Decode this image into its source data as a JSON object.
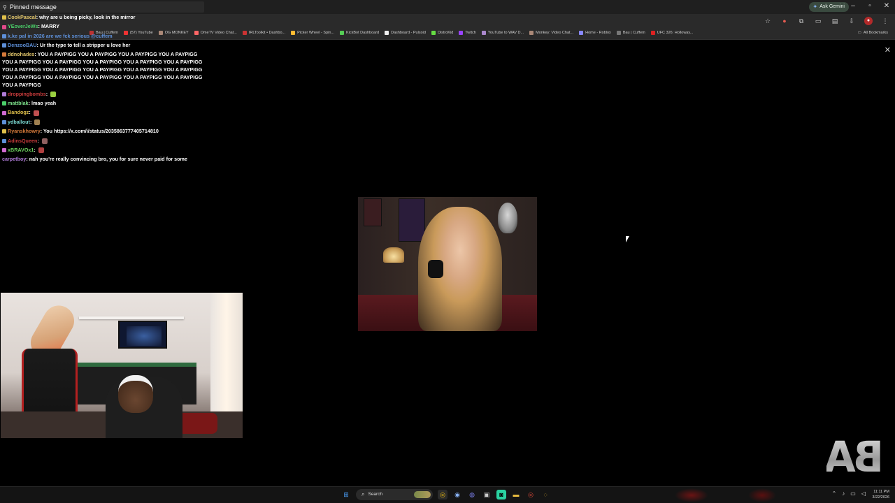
{
  "pinned": {
    "label": "Pinned message"
  },
  "window": {
    "ask_gemini": "Ask Gemini"
  },
  "bookmarks": {
    "items": [
      {
        "label": "Bau | Cuffem",
        "color": "#b33"
      },
      {
        "label": "(57) YouTube",
        "color": "#e33"
      },
      {
        "label": "OG MONKEY",
        "color": "#a87"
      },
      {
        "label": "OmeTV Video Chat...",
        "color": "#f66"
      },
      {
        "label": "IRLToolkit • Dashbo...",
        "color": "#c33"
      },
      {
        "label": "Picker Wheel - Spin...",
        "color": "#fb3"
      },
      {
        "label": "KickBot Dashboard",
        "color": "#5c5"
      },
      {
        "label": "Dashboard - Pulsoid",
        "color": "#eee"
      },
      {
        "label": "DistroKid",
        "color": "#6d4"
      },
      {
        "label": "Twitch",
        "color": "#94f"
      },
      {
        "label": "YouTube to WAV D...",
        "color": "#a8c"
      },
      {
        "label": "Monkey: Video Chat...",
        "color": "#a87"
      },
      {
        "label": "Home - Roblox",
        "color": "#88f"
      },
      {
        "label": "Bau | Cuffem",
        "color": "#777"
      },
      {
        "label": "UFC 326: Holloway...",
        "color": "#d22"
      }
    ],
    "all_bookmarks": "All Bookmarks"
  },
  "chat": [
    {
      "user": "CookPascal",
      "user_color": "gold",
      "text": "why are u being picky, look in the mirror",
      "badge": "#e0c04a"
    },
    {
      "user": "YEoverJeWs",
      "user_color": "green",
      "text": "MARRY",
      "badge": "#e04a8a"
    },
    {
      "user": "k.ke pal in 2026 are we fck serious @cuffem",
      "user_color": "blue",
      "text": "",
      "badge": "#5d8fd8"
    },
    {
      "user": "DenzooBAU",
      "user_color": "blue",
      "text": "Ur the type to tell a stripper u love her",
      "badge": "#5d8fd8"
    },
    {
      "user": "ddnohades",
      "user_color": "gold",
      "text": "YOU A PAYPIGG YOU A PAYPIGG YOU A PAYPIGG YOU A PAYPIGG YOU A PAYPIGG YOU A PAYPIGG YOU A PAYPIGG YOU A PAYPIGG YOU A PAYPIGG YOU A PAYPIGG YOU A PAYPIGG YOU A PAYPIGG YOU A PAYPIGG YOU A PAYPIGG YOU A PAYPIGG YOU A PAYPIGG YOU A PAYPIGG YOU A PAYPIGG YOU A PAYPIGG YOU A PAYPIGG",
      "badge": "#d67a3a"
    },
    {
      "user": "droppingbombs",
      "user_color": "red",
      "text": "",
      "badge": "#b07cd8",
      "emote": "#9ad040"
    },
    {
      "user": "mattblak",
      "user_color": "ltgreen",
      "text": "lmao yeah",
      "badge": "#4bd06a"
    },
    {
      "user": "Bandogz",
      "user_color": "yellow",
      "text": "",
      "badge": "#d06ad0",
      "emote": "#c05050"
    },
    {
      "user": "ydballout",
      "user_color": "cyan",
      "text": "",
      "badge": "#5d8fd8",
      "emote": "#a08050"
    },
    {
      "user": "Ryanskhowry",
      "user_color": "orange",
      "text": "You https://x.com/i/status/2035863777405714810",
      "badge": "#e0c04a"
    },
    {
      "user": "AdinsQueen",
      "user_color": "red",
      "text": "",
      "badge": "#5d8fd8",
      "emote": "#906060"
    },
    {
      "user": "xBRAVOx1",
      "user_color": "lime",
      "text": "",
      "badge": "#d06ad0",
      "emote": "#b04040"
    },
    {
      "user": "carpetboy",
      "user_color": "purple",
      "text": "nah you're really convincing bro, you for sure never paid for some",
      "badge": ""
    }
  ],
  "watermark": {
    "text": "BAU"
  },
  "taskbar": {
    "search_label": "Search",
    "time": "11:11 PM",
    "date": "3/22/2026"
  }
}
